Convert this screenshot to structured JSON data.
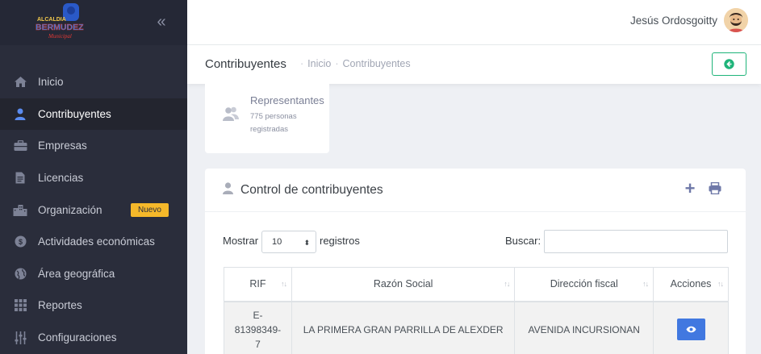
{
  "brand": {
    "logo_text_top": "ALCALDIA",
    "logo_text_main": "BERMUDEZ",
    "logo_text_sub": "Municipal",
    "colors": {
      "sidebar": "#2a2d3b",
      "accent_green": "#1fb47a",
      "accent_blue": "#4178e0",
      "badge": "#f5b82a"
    }
  },
  "sidebar": {
    "collapse_icon": "double-chevron-left-icon",
    "items": [
      {
        "label": "Inicio",
        "icon": "home-icon",
        "active": false
      },
      {
        "label": "Contribuyentes",
        "icon": "user-icon",
        "active": true
      },
      {
        "label": "Empresas",
        "icon": "briefcase-icon",
        "active": false
      },
      {
        "label": "Licencias",
        "icon": "document-icon",
        "active": false
      },
      {
        "label": "Organización",
        "icon": "buildings-icon",
        "active": false,
        "badge": "Nuevo"
      },
      {
        "label": "Actividades económicas",
        "icon": "coins-icon",
        "active": false
      },
      {
        "label": "Área geográfica",
        "icon": "globe-icon",
        "active": false
      },
      {
        "label": "Reportes",
        "icon": "grid-icon",
        "active": false
      },
      {
        "label": "Configuraciones",
        "icon": "sliders-icon",
        "active": false
      }
    ]
  },
  "topbar": {
    "user_name": "Jesús Ordosgoitty",
    "avatar_icon": "avatar-icon"
  },
  "header": {
    "title": "Contribuyentes",
    "breadcrumb": [
      "Inicio",
      "Contribuyentes"
    ],
    "back_icon": "arrow-left-circle-icon"
  },
  "rep_card": {
    "title": "Representantes",
    "subtitle": "775 personas registradas",
    "icon": "users-icon"
  },
  "card": {
    "title": "Control de contribuyentes",
    "add_icon": "plus-icon",
    "print_icon": "print-icon"
  },
  "controls": {
    "show_label": "Mostrar",
    "show_value": "10",
    "records_label": "registros",
    "search_label": "Buscar:",
    "search_value": ""
  },
  "table": {
    "columns": [
      "RIF",
      "Razón Social",
      "Dirección fiscal",
      "Acciones"
    ],
    "rows": [
      {
        "rif": "E-81398349-7",
        "rif_lines": [
          "E-",
          "81398349-",
          "7"
        ],
        "razon_social": "LA PRIMERA GRAN PARRILLA DE ALEXDER",
        "direccion": "AVENIDA INCURSIONAN",
        "action_icon": "eye-icon"
      }
    ]
  }
}
